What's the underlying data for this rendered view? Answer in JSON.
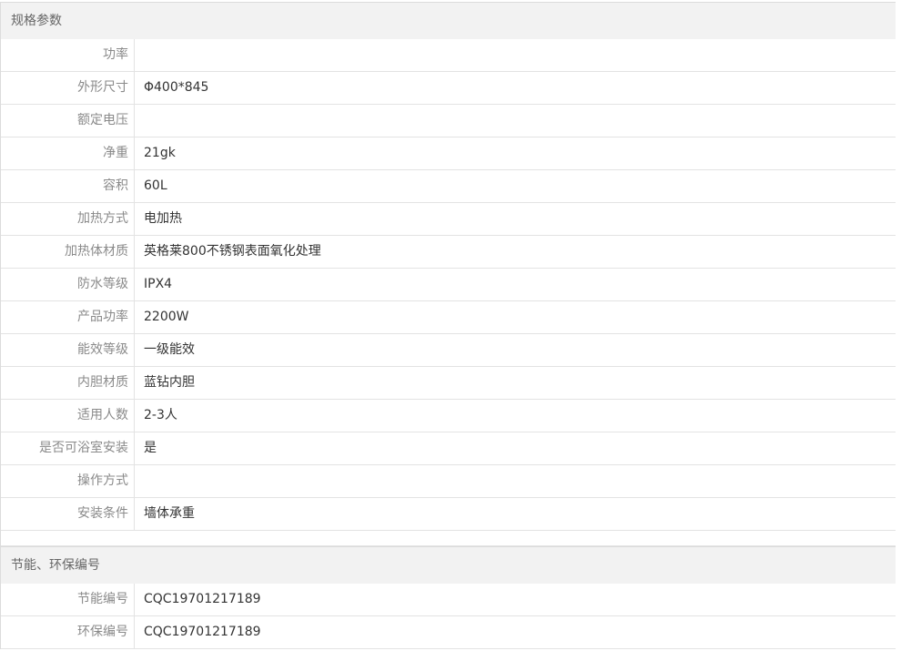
{
  "spec": {
    "title": "规格参数",
    "rows": [
      {
        "label": "功率",
        "value": ""
      },
      {
        "label": "外形尺寸",
        "value": "Φ400*845"
      },
      {
        "label": "额定电压",
        "value": ""
      },
      {
        "label": "净重",
        "value": "21gk"
      },
      {
        "label": "容积",
        "value": "60L"
      },
      {
        "label": "加热方式",
        "value": "电加热"
      },
      {
        "label": "加热体材质",
        "value": "英格莱800不锈钢表面氧化处理"
      },
      {
        "label": "防水等级",
        "value": "IPX4"
      },
      {
        "label": "产品功率",
        "value": "2200W"
      },
      {
        "label": "能效等级",
        "value": "一级能效"
      },
      {
        "label": "内胆材质",
        "value": "蓝钻内胆"
      },
      {
        "label": "适用人数",
        "value": "2-3人"
      },
      {
        "label": "是否可浴室安装",
        "value": "是"
      },
      {
        "label": "操作方式",
        "value": ""
      },
      {
        "label": "安装条件",
        "value": "墙体承重"
      }
    ]
  },
  "eco": {
    "title": "节能、环保编号",
    "rows": [
      {
        "label": "节能编号",
        "value": "CQC19701217189"
      },
      {
        "label": "环保编号",
        "value": "CQC19701217189"
      }
    ]
  }
}
